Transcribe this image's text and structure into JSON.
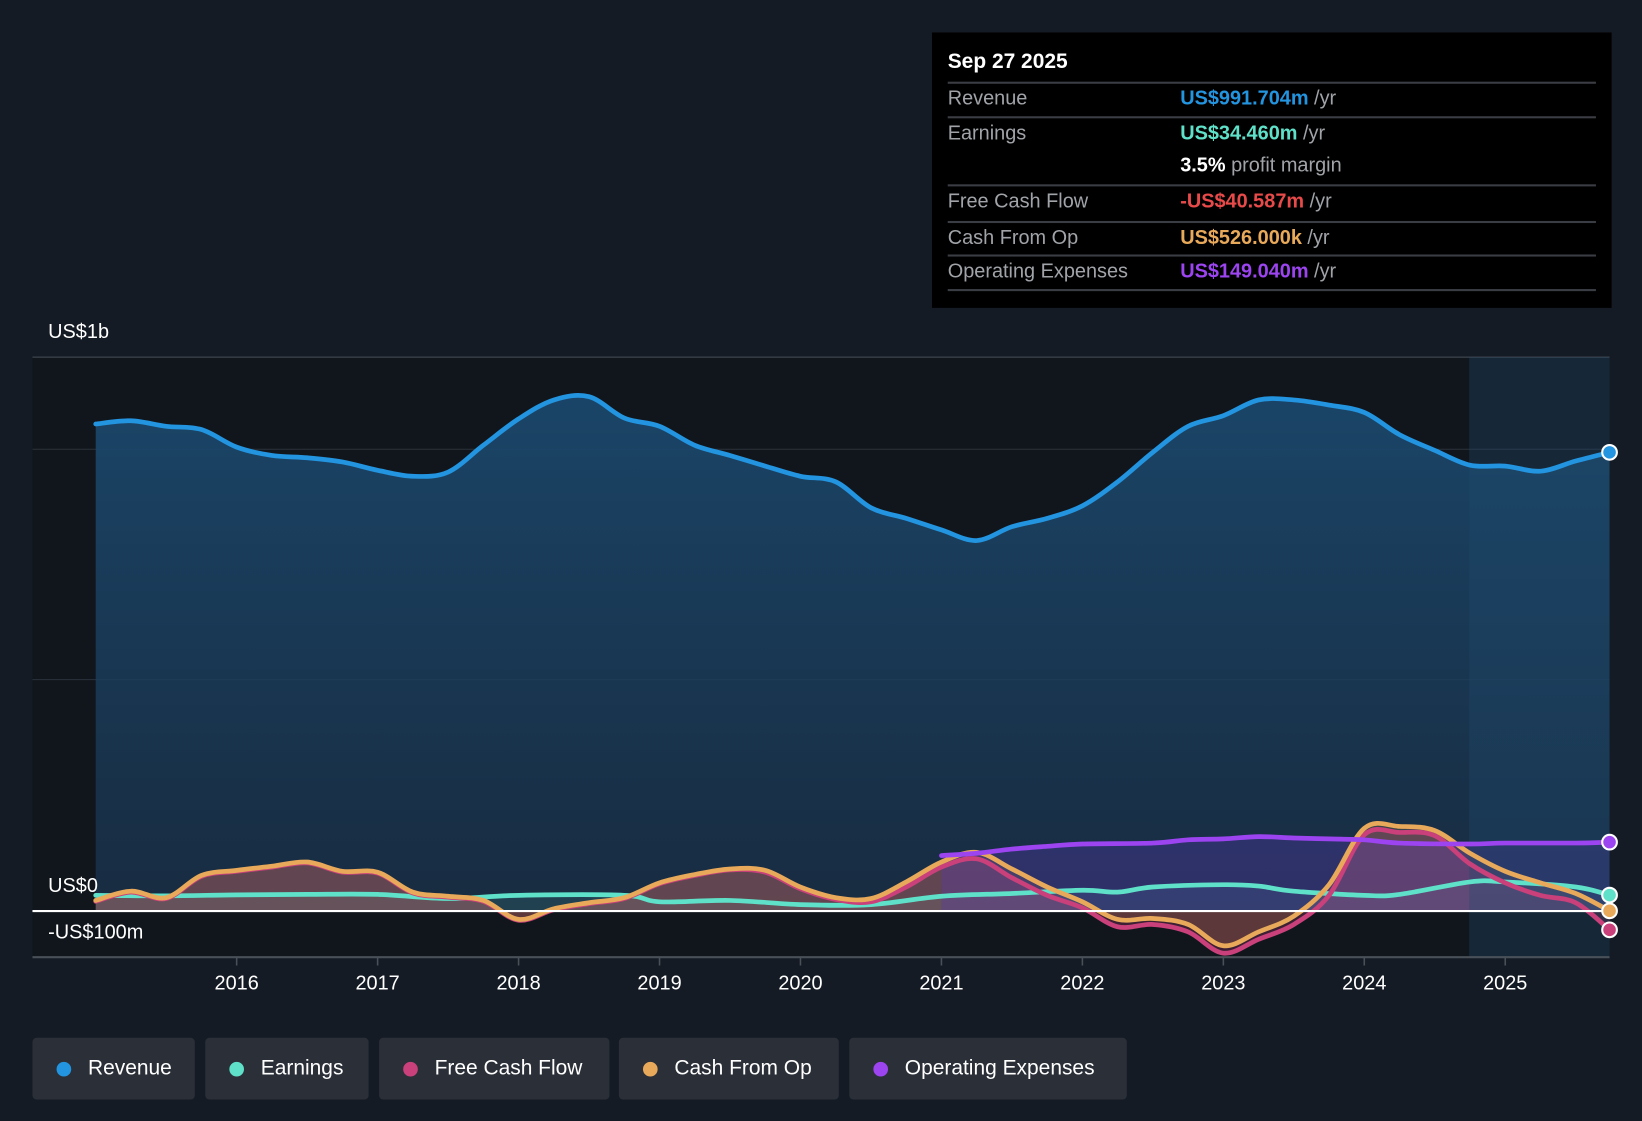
{
  "tooltip": {
    "date": "Sep 27 2025",
    "rows": [
      {
        "label": "Revenue",
        "value": "US$991.704m",
        "unit": "/yr",
        "color": "#2394df"
      },
      {
        "label": "Earnings",
        "value": "US$34.460m",
        "unit": "/yr",
        "color": "#5fe0c8"
      },
      {
        "label": "",
        "value": "3.5%",
        "unit": "profit margin",
        "color": "#ffffff"
      },
      {
        "label": "Free Cash Flow",
        "value": "-US$40.587m",
        "unit": "/yr",
        "color": "#e84a4a"
      },
      {
        "label": "Cash From Op",
        "value": "US$526.000k",
        "unit": "/yr",
        "color": "#e8a95a"
      },
      {
        "label": "Operating Expenses",
        "value": "US$149.040m",
        "unit": "/yr",
        "color": "#9b44f0"
      }
    ]
  },
  "chart_data": {
    "type": "line",
    "ylabels": {
      "top": "US$1b",
      "zero": "US$0",
      "neg": "-US$100m"
    },
    "ylim": [
      -100,
      1200
    ],
    "xlim": [
      2015,
      2025.74
    ],
    "xticks": [
      "2016",
      "2017",
      "2018",
      "2019",
      "2020",
      "2021",
      "2022",
      "2023",
      "2024",
      "2025"
    ],
    "units": "US$m",
    "series": [
      {
        "name": "Revenue",
        "color": "#2394df",
        "x": [
          2015,
          2015.25,
          2015.5,
          2015.75,
          2016,
          2016.25,
          2016.5,
          2016.75,
          2017,
          2017.25,
          2017.5,
          2017.75,
          2018,
          2018.25,
          2018.5,
          2018.75,
          2019,
          2019.25,
          2019.5,
          2019.75,
          2020,
          2020.25,
          2020.5,
          2020.75,
          2021,
          2021.25,
          2021.5,
          2021.75,
          2022,
          2022.25,
          2022.5,
          2022.75,
          2023,
          2023.25,
          2023.5,
          2023.75,
          2024,
          2024.25,
          2024.5,
          2024.75,
          2025,
          2025.25,
          2025.5,
          2025.74
        ],
        "y": [
          1053,
          1060,
          1048,
          1041,
          1003,
          985,
          980,
          971,
          953,
          940,
          949,
          1007,
          1064,
          1105,
          1112,
          1066,
          1048,
          1007,
          985,
          962,
          940,
          928,
          872,
          849,
          824,
          801,
          831,
          849,
          876,
          928,
          992,
          1048,
          1071,
          1105,
          1105,
          1094,
          1078,
          1030,
          996,
          964,
          962,
          951,
          973,
          991.7
        ]
      },
      {
        "name": "Earnings",
        "color": "#5fe0c8",
        "x": [
          2015,
          2015.5,
          2016,
          2016.5,
          2017,
          2017.5,
          2018,
          2018.75,
          2019,
          2019.5,
          2020,
          2020.5,
          2021,
          2021.5,
          2022,
          2022.25,
          2022.5,
          2023,
          2023.25,
          2023.5,
          2024,
          2024.25,
          2024.75,
          2025,
          2025.5,
          2025.74
        ],
        "y": [
          34,
          33,
          35,
          36,
          36,
          27,
          34,
          34,
          20,
          23,
          14,
          14,
          32,
          38,
          45,
          41,
          52,
          57,
          54,
          43,
          34,
          36,
          63,
          63,
          52,
          34.5
        ]
      },
      {
        "name": "Free Cash Flow",
        "color": "#c9407a",
        "x": [
          2015,
          2015.25,
          2015.5,
          2015.75,
          2016,
          2016.25,
          2016.5,
          2016.75,
          2017,
          2017.25,
          2017.5,
          2017.75,
          2018,
          2018.25,
          2018.5,
          2018.75,
          2019,
          2019.25,
          2019.5,
          2019.75,
          2020,
          2020.25,
          2020.5,
          2020.75,
          2021,
          2021.25,
          2021.5,
          2021.75,
          2022,
          2022.25,
          2022.5,
          2022.75,
          2023,
          2023.25,
          2023.5,
          2023.75,
          2024,
          2024.25,
          2024.5,
          2024.75,
          2025,
          2025.25,
          2025.5,
          2025.74
        ],
        "y": [
          21,
          41,
          27,
          75,
          86,
          95,
          104,
          84,
          82,
          39,
          30,
          21,
          -20,
          3,
          16,
          27,
          59,
          77,
          89,
          84,
          48,
          25,
          20,
          52,
          95,
          113,
          72,
          34,
          7,
          -34,
          -29,
          -45,
          -91,
          -61,
          -29,
          34,
          165,
          170,
          163,
          102,
          61,
          34,
          18,
          -40.6
        ]
      },
      {
        "name": "Cash From Op",
        "color": "#e8a95a",
        "x": [
          2015,
          2015.25,
          2015.5,
          2015.75,
          2016,
          2016.25,
          2016.5,
          2016.75,
          2017,
          2017.25,
          2017.5,
          2017.75,
          2018,
          2018.25,
          2018.5,
          2018.75,
          2019,
          2019.25,
          2019.5,
          2019.75,
          2020,
          2020.25,
          2020.5,
          2020.75,
          2021,
          2021.25,
          2021.5,
          2021.75,
          2022,
          2022.25,
          2022.5,
          2022.75,
          2023,
          2023.25,
          2023.5,
          2023.75,
          2024,
          2024.25,
          2024.5,
          2024.75,
          2025,
          2025.25,
          2025.5,
          2025.74
        ],
        "y": [
          23,
          43,
          29,
          77,
          88,
          97,
          106,
          86,
          84,
          41,
          32,
          23,
          -18,
          5,
          18,
          29,
          61,
          79,
          91,
          88,
          52,
          29,
          27,
          63,
          106,
          127,
          91,
          52,
          20,
          -18,
          -16,
          -29,
          -75,
          -45,
          -11,
          57,
          179,
          183,
          174,
          125,
          86,
          61,
          38,
          0.5
        ]
      },
      {
        "name": "Operating Expenses",
        "color": "#9b44f0",
        "x": [
          2021,
          2021.25,
          2021.5,
          2021.75,
          2022,
          2022.5,
          2022.75,
          2023,
          2023.25,
          2023.5,
          2023.75,
          2024,
          2024.25,
          2024.75,
          2025,
          2025.5,
          2025.74
        ],
        "y": [
          120,
          125,
          134,
          140,
          145,
          147,
          154,
          156,
          161,
          158,
          156,
          154,
          147,
          145,
          147,
          147,
          149
        ]
      }
    ]
  },
  "legend": [
    "Revenue",
    "Earnings",
    "Free Cash Flow",
    "Cash From Op",
    "Operating Expenses"
  ]
}
